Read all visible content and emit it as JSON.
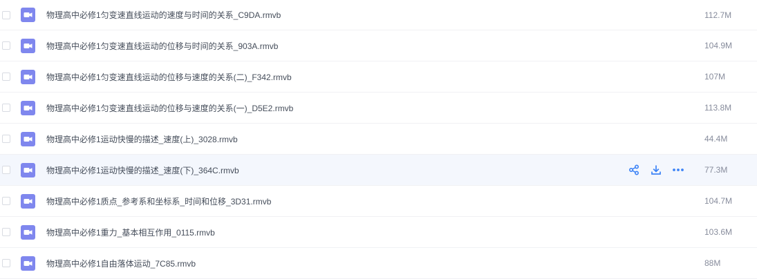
{
  "files": [
    {
      "name": "物理高中必修1匀变速直线运动的速度与时间的关系_C9DA.rmvb",
      "size": "112.7M",
      "icon": "video-file-icon"
    },
    {
      "name": "物理高中必修1匀变速直线运动的位移与时间的关系_903A.rmvb",
      "size": "104.9M",
      "icon": "video-file-icon"
    },
    {
      "name": "物理高中必修1匀变速直线运动的位移与速度的关系(二)_F342.rmvb",
      "size": "107M",
      "icon": "video-file-icon"
    },
    {
      "name": "物理高中必修1匀变速直线运动的位移与速度的关系(一)_D5E2.rmvb",
      "size": "113.8M",
      "icon": "video-file-icon"
    },
    {
      "name": "物理高中必修1运动快慢的描述_速度(上)_3028.rmvb",
      "size": "44.4M",
      "icon": "video-file-icon"
    },
    {
      "name": "物理高中必修1运动快慢的描述_速度(下)_364C.rmvb",
      "size": "77.3M",
      "icon": "video-file-icon",
      "hovered": true
    },
    {
      "name": "物理高中必修1质点_参考系和坐标系_时间和位移_3D31.rmvb",
      "size": "104.7M",
      "icon": "video-file-icon"
    },
    {
      "name": "物理高中必修1重力_基本相互作用_0115.rmvb",
      "size": "103.6M",
      "icon": "video-file-icon"
    },
    {
      "name": "物理高中必修1自由落体运动_7C85.rmvb",
      "size": "88M",
      "icon": "video-file-icon"
    }
  ],
  "hover_actions": [
    {
      "icon": "share-icon"
    },
    {
      "icon": "download-icon"
    },
    {
      "icon": "more-icon"
    }
  ],
  "colors": {
    "icon_bg": "#7f87ee",
    "action": "#3b82f6",
    "hover_row": "#f4f7fd",
    "name_text": "#454d5a",
    "size_text": "#878c9c"
  }
}
